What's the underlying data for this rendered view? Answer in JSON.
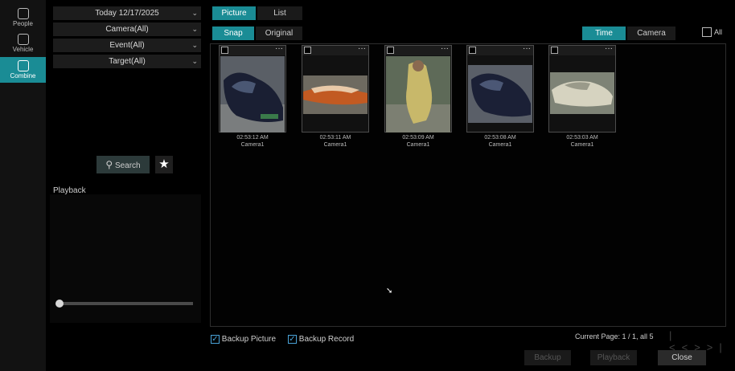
{
  "nav": {
    "items": [
      {
        "label": "People",
        "active": false
      },
      {
        "label": "Vehicle",
        "active": false
      },
      {
        "label": "Combine",
        "active": true
      }
    ]
  },
  "filters": {
    "date": "Today 12/17/2025",
    "camera": "Camera(All)",
    "event": "Event(All)",
    "target": "Target(All)"
  },
  "search_label": "Search",
  "playback_label": "Playback",
  "view_tabs": {
    "picture": "Picture",
    "list": "List"
  },
  "mode_tabs": {
    "snap": "Snap",
    "original": "Original"
  },
  "sort_tabs": {
    "time": "Time",
    "camera": "Camera"
  },
  "all_label": "All",
  "thumbs": [
    {
      "time": "02:53:12 AM",
      "camera": "Camera1"
    },
    {
      "time": "02:53:11 AM",
      "camera": "Camera1"
    },
    {
      "time": "02:53:09 AM",
      "camera": "Camera1"
    },
    {
      "time": "02:53:08 AM",
      "camera": "Camera1"
    },
    {
      "time": "02:53:03 AM",
      "camera": "Camera1"
    }
  ],
  "backup_picture": "Backup Picture",
  "backup_record": "Backup Record",
  "page_info": "Current Page: 1 / 1, all 5",
  "buttons": {
    "backup": "Backup",
    "playback": "Playback",
    "close": "Close"
  },
  "colors": {
    "accent": "#1a8c95",
    "check": "#4aa3d8"
  }
}
